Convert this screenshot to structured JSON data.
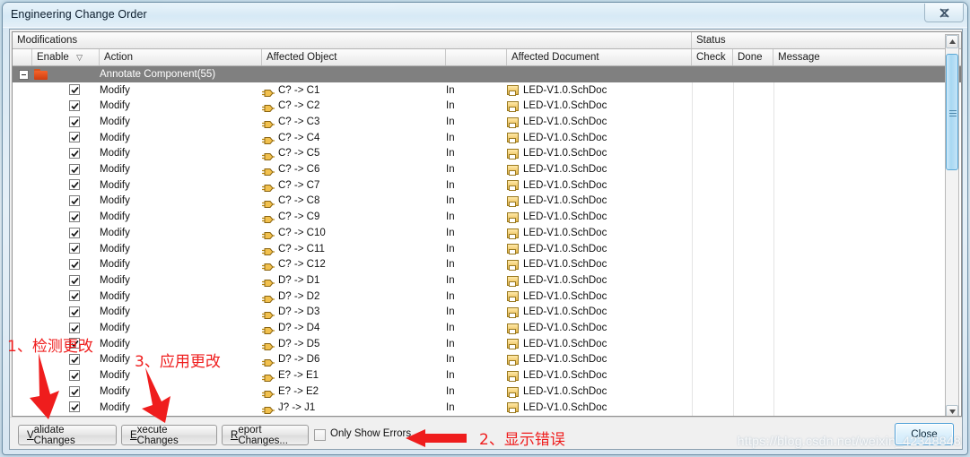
{
  "window": {
    "title": "Engineering Change Order",
    "close_icon": "close-x-icon"
  },
  "grid": {
    "group_headers": [
      {
        "label": "Modifications",
        "key": "modifications"
      },
      {
        "label": "Status",
        "key": "status"
      }
    ],
    "columns": [
      {
        "label": "",
        "key": "expand"
      },
      {
        "label": "Enable",
        "key": "enable",
        "sort_glyph": "▽"
      },
      {
        "label": "Action",
        "key": "action"
      },
      {
        "label": "Affected Object",
        "key": "affected_object"
      },
      {
        "label": "",
        "key": "direction"
      },
      {
        "label": "Affected Document",
        "key": "affected_document"
      },
      {
        "label": "Check",
        "key": "check"
      },
      {
        "label": "Done",
        "key": "done"
      },
      {
        "label": "Message",
        "key": "message"
      }
    ],
    "group_row": {
      "label": "Annotate Component(55)",
      "expander": "collapse-minus-icon",
      "folder_icon": "folder-icon"
    },
    "rows": [
      {
        "enabled": true,
        "action": "Modify",
        "affected_object": "C? -> C1",
        "direction": "In",
        "affected_document": "LED-V1.0.SchDoc",
        "check": "",
        "done": "",
        "message": ""
      },
      {
        "enabled": true,
        "action": "Modify",
        "affected_object": "C? -> C2",
        "direction": "In",
        "affected_document": "LED-V1.0.SchDoc",
        "check": "",
        "done": "",
        "message": ""
      },
      {
        "enabled": true,
        "action": "Modify",
        "affected_object": "C? -> C3",
        "direction": "In",
        "affected_document": "LED-V1.0.SchDoc",
        "check": "",
        "done": "",
        "message": ""
      },
      {
        "enabled": true,
        "action": "Modify",
        "affected_object": "C? -> C4",
        "direction": "In",
        "affected_document": "LED-V1.0.SchDoc",
        "check": "",
        "done": "",
        "message": ""
      },
      {
        "enabled": true,
        "action": "Modify",
        "affected_object": "C? -> C5",
        "direction": "In",
        "affected_document": "LED-V1.0.SchDoc",
        "check": "",
        "done": "",
        "message": ""
      },
      {
        "enabled": true,
        "action": "Modify",
        "affected_object": "C? -> C6",
        "direction": "In",
        "affected_document": "LED-V1.0.SchDoc",
        "check": "",
        "done": "",
        "message": ""
      },
      {
        "enabled": true,
        "action": "Modify",
        "affected_object": "C? -> C7",
        "direction": "In",
        "affected_document": "LED-V1.0.SchDoc",
        "check": "",
        "done": "",
        "message": ""
      },
      {
        "enabled": true,
        "action": "Modify",
        "affected_object": "C? -> C8",
        "direction": "In",
        "affected_document": "LED-V1.0.SchDoc",
        "check": "",
        "done": "",
        "message": ""
      },
      {
        "enabled": true,
        "action": "Modify",
        "affected_object": "C? -> C9",
        "direction": "In",
        "affected_document": "LED-V1.0.SchDoc",
        "check": "",
        "done": "",
        "message": ""
      },
      {
        "enabled": true,
        "action": "Modify",
        "affected_object": "C? -> C10",
        "direction": "In",
        "affected_document": "LED-V1.0.SchDoc",
        "check": "",
        "done": "",
        "message": ""
      },
      {
        "enabled": true,
        "action": "Modify",
        "affected_object": "C? -> C11",
        "direction": "In",
        "affected_document": "LED-V1.0.SchDoc",
        "check": "",
        "done": "",
        "message": ""
      },
      {
        "enabled": true,
        "action": "Modify",
        "affected_object": "C? -> C12",
        "direction": "In",
        "affected_document": "LED-V1.0.SchDoc",
        "check": "",
        "done": "",
        "message": ""
      },
      {
        "enabled": true,
        "action": "Modify",
        "affected_object": "D? -> D1",
        "direction": "In",
        "affected_document": "LED-V1.0.SchDoc",
        "check": "",
        "done": "",
        "message": ""
      },
      {
        "enabled": true,
        "action": "Modify",
        "affected_object": "D? -> D2",
        "direction": "In",
        "affected_document": "LED-V1.0.SchDoc",
        "check": "",
        "done": "",
        "message": ""
      },
      {
        "enabled": true,
        "action": "Modify",
        "affected_object": "D? -> D3",
        "direction": "In",
        "affected_document": "LED-V1.0.SchDoc",
        "check": "",
        "done": "",
        "message": ""
      },
      {
        "enabled": true,
        "action": "Modify",
        "affected_object": "D? -> D4",
        "direction": "In",
        "affected_document": "LED-V1.0.SchDoc",
        "check": "",
        "done": "",
        "message": ""
      },
      {
        "enabled": true,
        "action": "Modify",
        "affected_object": "D? -> D5",
        "direction": "In",
        "affected_document": "LED-V1.0.SchDoc",
        "check": "",
        "done": "",
        "message": ""
      },
      {
        "enabled": true,
        "action": "Modify",
        "affected_object": "D? -> D6",
        "direction": "In",
        "affected_document": "LED-V1.0.SchDoc",
        "check": "",
        "done": "",
        "message": ""
      },
      {
        "enabled": true,
        "action": "Modify",
        "affected_object": "E? -> E1",
        "direction": "In",
        "affected_document": "LED-V1.0.SchDoc",
        "check": "",
        "done": "",
        "message": ""
      },
      {
        "enabled": true,
        "action": "Modify",
        "affected_object": "E? -> E2",
        "direction": "In",
        "affected_document": "LED-V1.0.SchDoc",
        "check": "",
        "done": "",
        "message": ""
      },
      {
        "enabled": true,
        "action": "Modify",
        "affected_object": "J? -> J1",
        "direction": "In",
        "affected_document": "LED-V1.0.SchDoc",
        "check": "",
        "done": "",
        "message": ""
      }
    ]
  },
  "scrollbar": {
    "up_icon": "scroll-up-arrow-icon",
    "down_icon": "scroll-down-arrow-icon",
    "thumb_icon": "scroll-thumb-grip"
  },
  "footer": {
    "validate_pre": "V",
    "validate_post": "alidate Changes",
    "execute_pre": "E",
    "execute_post": "xecute Changes",
    "report_pre": "R",
    "report_post": "eport Changes...",
    "only_show_errors": "Only Show Errors",
    "only_show_errors_checked": false,
    "close": "Close"
  },
  "annotations": [
    {
      "text": "1、检测更改",
      "color": "#ef1d1d"
    },
    {
      "text": "3、应用更改",
      "color": "#ef1d1d"
    },
    {
      "text": "2、显示错误",
      "color": "#ef1d1d"
    }
  ],
  "watermark": "https://blog.csdn.net/weixin_42348848"
}
